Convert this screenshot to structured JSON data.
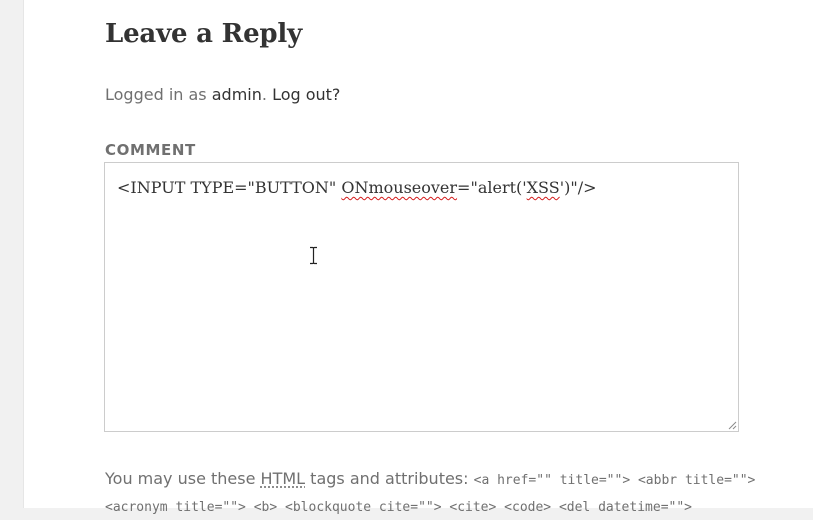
{
  "reply": {
    "title": "Leave a Reply",
    "logged_in_prefix": "Logged in as",
    "user": "admin",
    "logout_text": "Log out?"
  },
  "comment": {
    "label": "COMMENT",
    "value": "<INPUT TYPE=\"BUTTON\" ONmouseover=\"alert('XSS')\"/>",
    "parts": {
      "a": "<INPUT TYPE=\"BUTTON\" ",
      "b": "ONmouseover",
      "c": "=\"alert('",
      "d": "XSS",
      "e": "')\"/>"
    }
  },
  "allowed_tags": {
    "intro_before": "You may use these",
    "abbr": "HTML",
    "intro_after": "tags and attributes:",
    "line1": "<a href=\"\" title=\"\"> <abbr title=\"\">",
    "line2": "<acronym title=\"\"> <b> <blockquote cite=\"\"> <cite> <code> <del datetime=\"\">"
  },
  "icons": {
    "cursor": "text-cursor-icon",
    "resize": "resize-handle-icon"
  }
}
